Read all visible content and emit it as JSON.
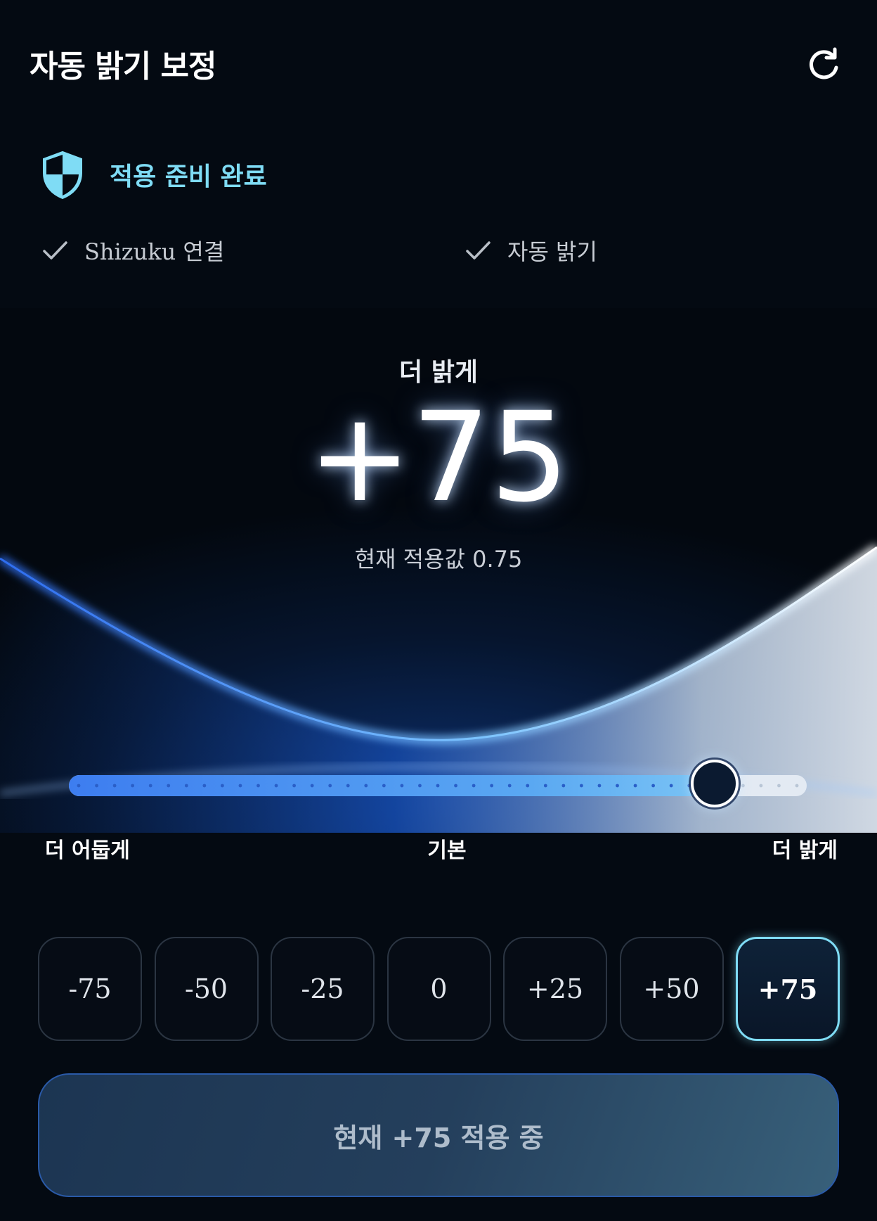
{
  "header": {
    "title": "자동 밝기 보정",
    "refresh_icon": "refresh-icon"
  },
  "status": {
    "icon": "shield-icon",
    "text": "적용 준비 완료",
    "color": "#7fdcf5",
    "checks": [
      {
        "label": "Shizuku 연결",
        "icon": "check-icon"
      },
      {
        "label": "자동 밝기",
        "icon": "check-icon"
      }
    ]
  },
  "hero": {
    "label": "더 밝게",
    "value": "+75",
    "subtitle": "현재 적용값 0.75"
  },
  "slider": {
    "min": -100,
    "max": 100,
    "value": 75,
    "labels": {
      "left": "더 어둡게",
      "middle": "기본",
      "right": "더 밝게"
    }
  },
  "presets": {
    "items": [
      "-75",
      "-50",
      "-25",
      "0",
      "+25",
      "+50",
      "+75"
    ],
    "selected_index": 6
  },
  "apply_button": {
    "label": "현재 +75 적용 중"
  },
  "colors": {
    "background": "#040a12",
    "accent": "#7fdcf5",
    "slider_fill": "#3d7df0"
  }
}
